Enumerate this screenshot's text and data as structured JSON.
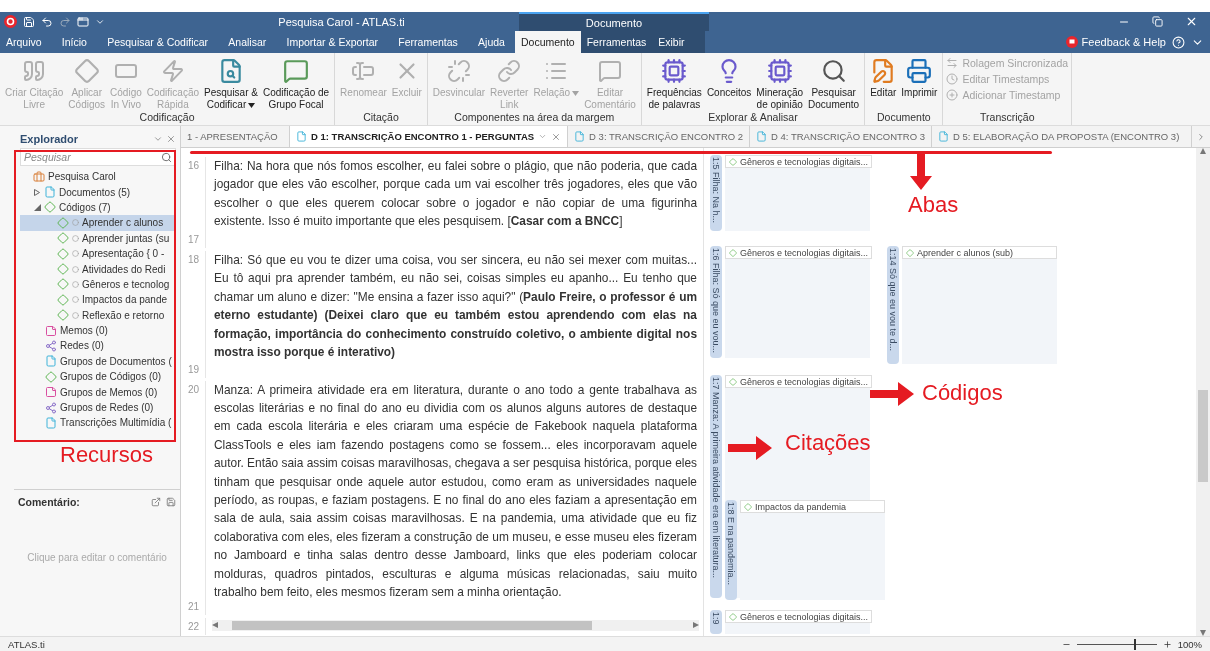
{
  "title_bar": {
    "title": "Pesquisa Carol - ATLAS.ti",
    "context_label": "Documento"
  },
  "menu": [
    {
      "label": "Arquivo",
      "selected": false,
      "contextual": false
    },
    {
      "label": "Início",
      "selected": false,
      "contextual": false
    },
    {
      "label": "Pesquisar & Codificar",
      "selected": false,
      "contextual": false
    },
    {
      "label": "Analisar",
      "selected": false,
      "contextual": false
    },
    {
      "label": "Importar & Exportar",
      "selected": false,
      "contextual": false
    },
    {
      "label": "Ferramentas",
      "selected": false,
      "contextual": false
    },
    {
      "label": "Ajuda",
      "selected": false,
      "contextual": false
    },
    {
      "label": "Documento",
      "selected": true,
      "contextual": true
    },
    {
      "label": "Ferramentas",
      "selected": false,
      "contextual": true
    },
    {
      "label": "Exibir",
      "selected": false,
      "contextual": true
    }
  ],
  "help": {
    "label": "Feedback & Help"
  },
  "ribbon": [
    {
      "group": "Codificação",
      "kind": "large",
      "buttons": [
        {
          "label": "Criar Citação\nLivre",
          "disabled": true,
          "dropdown": false
        },
        {
          "label": "Aplicar\nCódigos",
          "disabled": true,
          "dropdown": false
        },
        {
          "label": "Código\nIn Vivo",
          "disabled": true,
          "dropdown": false
        },
        {
          "label": "Codificação\nRápida",
          "disabled": true,
          "dropdown": false
        },
        {
          "label": "Pesquisar &\nCodificar",
          "disabled": false,
          "dropdown": true
        },
        {
          "label": "Codificação de\nGrupo Focal",
          "disabled": false,
          "dropdown": false
        }
      ]
    },
    {
      "group": "Citação",
      "kind": "large",
      "buttons": [
        {
          "label": "Renomear",
          "disabled": true,
          "dropdown": false
        },
        {
          "label": "Excluir",
          "disabled": true,
          "dropdown": false
        }
      ]
    },
    {
      "group": "Componentes na área da margem",
      "kind": "large",
      "buttons": [
        {
          "label": "Desvincular",
          "disabled": true,
          "dropdown": false
        },
        {
          "label": "Reverter\nLink",
          "disabled": true,
          "dropdown": false
        },
        {
          "label": "Relação",
          "disabled": true,
          "dropdown": true
        },
        {
          "label": "Editar\nComentário",
          "disabled": true,
          "dropdown": false
        }
      ]
    },
    {
      "group": "Explorar & Analisar",
      "kind": "large",
      "buttons": [
        {
          "label": "Frequências\nde palavras",
          "disabled": false,
          "dropdown": false
        },
        {
          "label": "Conceitos",
          "disabled": false,
          "dropdown": false
        },
        {
          "label": "Mineração\nde opinião",
          "disabled": false,
          "dropdown": false
        },
        {
          "label": "Pesquisar\nDocumento",
          "disabled": false,
          "dropdown": false
        }
      ]
    },
    {
      "group": "Documento",
      "kind": "large",
      "buttons": [
        {
          "label": "Editar",
          "disabled": false,
          "dropdown": false
        },
        {
          "label": "Imprimir",
          "disabled": false,
          "dropdown": false
        }
      ]
    },
    {
      "group": "Transcrição",
      "kind": "small",
      "buttons": [
        {
          "label": "Rolagem Sincronizada",
          "disabled": true
        },
        {
          "label": "Editar Timestamps",
          "disabled": true
        },
        {
          "label": "Adicionar Timestamp",
          "disabled": true
        }
      ]
    }
  ],
  "explorer": {
    "title": "Explorador",
    "search_placeholder": "Pesquisar",
    "tree": [
      {
        "label": "Pesquisa Carol",
        "kind": "project",
        "selected": false,
        "children": [
          {
            "label": "Documentos (5)",
            "kind": "document",
            "selected": false,
            "expanded": false
          },
          {
            "label": "Códigos (7)",
            "kind": "code",
            "selected": false,
            "expanded": true,
            "children": [
              {
                "label": "Aprender c alunos",
                "kind": "code-item",
                "selected": true
              },
              {
                "label": "Aprender juntas (su",
                "kind": "code-item",
                "selected": false
              },
              {
                "label": "Apresentação  { 0 -",
                "kind": "code-item",
                "selected": false
              },
              {
                "label": "Atividades do Redi",
                "kind": "code-item",
                "selected": false
              },
              {
                "label": "Gêneros e tecnolog",
                "kind": "code-item",
                "selected": false
              },
              {
                "label": "Impactos da pande",
                "kind": "code-item",
                "selected": false
              },
              {
                "label": "Reflexão e retorno",
                "kind": "code-item",
                "selected": false
              }
            ]
          },
          {
            "label": "Memos (0)",
            "kind": "memo",
            "selected": false
          },
          {
            "label": "Redes (0)",
            "kind": "network",
            "selected": false
          },
          {
            "label": "Grupos de Documentos (",
            "kind": "document-group",
            "selected": false
          },
          {
            "label": "Grupos de Códigos (0)",
            "kind": "code-group",
            "selected": false
          },
          {
            "label": "Grupos de Memos (0)",
            "kind": "memo-group",
            "selected": false
          },
          {
            "label": "Grupos de Redes (0)",
            "kind": "network-group",
            "selected": false
          },
          {
            "label": "Transcrições Multimídia (",
            "kind": "transcript",
            "selected": false
          }
        ]
      }
    ]
  },
  "comment": {
    "title": "Comentário:",
    "placeholder": "Clique para editar o comentário"
  },
  "doc_tabs": [
    {
      "label": "1 - APRESENTAÇÃO",
      "selected": false
    },
    {
      "label": "D 1: TRANSCRIÇÃO ENCONTRO 1 - PERGUNTAS",
      "selected": true
    },
    {
      "label": "D 3: TRANSCRIÇÃO ENCONTRO 2",
      "selected": false
    },
    {
      "label": "D 4: TRANSCRIÇÃO ENCONTRO 3",
      "selected": false
    },
    {
      "label": "D 5: ELABORAÇÃO DA PROPOSTA (ENCONTRO 3)",
      "selected": false
    }
  ],
  "paragraphs": [
    {
      "number": "16",
      "text": "Filha: Na hora que nós fomos escolher, eu falei sobre o plágio, que não poderia, que cada jogador que eles vão escolher, porque cada um vai escolher três jogadores, eles que vão escolher o que eles querem colocar sobre o jogador e não copiar de uma figurinha existente. Isso é muito importante que eles pesquisem. [**Casar com a BNCC**]"
    },
    {
      "number": "17"
    },
    {
      "number": "18",
      "text": "Filha: Só que eu vou te dizer uma coisa, vou ser sincera, eu não sei mexer com muitas... Eu tô aqui pra aprender também, eu não sei, coisas simples eu apanho... Eu tenho que chamar um aluno e dizer: \"Me ensina a fazer isso aqui?\" (**Paulo Freire, o professor é um eterno estudante) (Deixei claro que eu também estou aprendendo com elas na formação, importância do conhecimento construído coletivo, o ambiente digital nos mostra isso porque é interativo)**"
    },
    {
      "number": "19"
    },
    {
      "number": "20",
      "text": "Manza: A primeira atividade era em literatura, durante o ano todo a gente trabalhava as escolas literárias e no final do ano eu dividia com os alunos alguns autores de destaque em cada escola literária e eles criaram uma espécie de Fakebook naquela plataforma ClassTools e eles iam fazendo postagens como se fossem... eles incorporavam aquele autor. Então saia assim coisas maravilhosas, chegava a ser pesquisa histórica, porque eles tinham que pesquisar onde aquele autor estudou, como eram as universidades naquele período, as roupas, e faziam postagens. E no final do ano eles faziam a apresentação em sala de aula, saia assim coisas maravilhosas. E na pandemia, uma atividade que eu fiz colaborativa com eles, eles fizeram a construção de um museu, e esse museu eles fizeram no Jamboard e tinha salas dentro desse Jamboard, links que eles poderiam colocar molduras, quadros pintados, esculturas e alguma músicas relacionadas, saiu muito trabalho bem feito, eles mesmos fizeram sem a minha orientação."
    },
    {
      "number": "21"
    },
    {
      "number": "22"
    }
  ],
  "quotations": [
    {
      "label": "1:5 Filha: Na h...",
      "code": "Gêneros e tecnologias digitais..."
    },
    {
      "label": "1:6 Filha: Só que eu vou...",
      "code": "Gêneros e tecnologias digitais..."
    },
    {
      "label": "1:14 Só que eu vou te d...",
      "code": "Aprender c alunos (sub)"
    },
    {
      "label": "1:7 Manza: A primeira atividade era em literatura...",
      "code": "Gêneros e tecnologias digitais..."
    },
    {
      "label": "1:8 E na pandemia...",
      "code": "Impactos da pandemia"
    },
    {
      "label": "1:9",
      "code": "Gêneros e tecnologias digitais..."
    }
  ],
  "annotations": {
    "resources": "Recursos",
    "tabs": "Abas",
    "codes": "Códigos",
    "quotes": "Citações"
  },
  "status": {
    "app": "ATLAS.ti",
    "zoom": "100%",
    "level": 0.72
  }
}
